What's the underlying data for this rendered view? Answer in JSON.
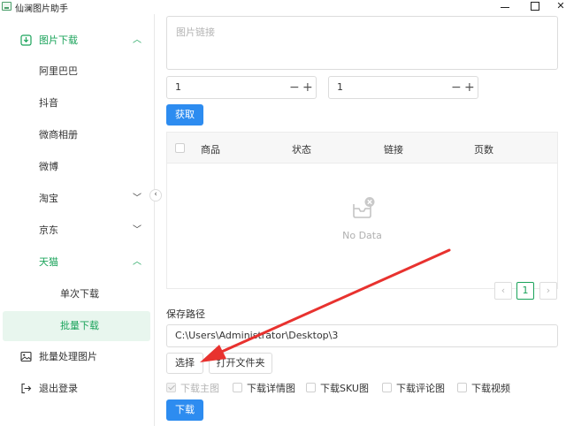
{
  "window": {
    "title": "仙澜图片助手"
  },
  "sidebar": {
    "items": [
      {
        "label": "图片下载",
        "type": "group",
        "expanded": true
      },
      {
        "label": "阿里巴巴"
      },
      {
        "label": "抖音"
      },
      {
        "label": "微商相册"
      },
      {
        "label": "微博"
      },
      {
        "label": "淘宝",
        "type": "group",
        "expanded": false
      },
      {
        "label": "京东",
        "type": "group",
        "expanded": false
      },
      {
        "label": "天猫",
        "type": "group",
        "expanded": true
      },
      {
        "label": "单次下载"
      },
      {
        "label": "批量下载",
        "selected": true
      },
      {
        "label": "批量处理图片"
      },
      {
        "label": "退出登录"
      }
    ]
  },
  "main": {
    "link_placeholder": "图片链接",
    "stepper_start": "1",
    "stepper_end": "1",
    "fetch_label": "获取",
    "table": {
      "columns": [
        "商品",
        "状态",
        "链接",
        "页数"
      ],
      "empty_text": "No Data"
    },
    "pagination": {
      "current_page": "1"
    },
    "save_path_label": "保存路径",
    "save_path_value": "C:\\Users\\Administrator\\Desktop\\3",
    "choose_label": "选择",
    "open_folder_label": "打开文件夹",
    "options": [
      {
        "label": "下载主图",
        "checked": true,
        "disabled": true
      },
      {
        "label": "下载详情图",
        "checked": false
      },
      {
        "label": "下载SKU图",
        "checked": false
      },
      {
        "label": "下载评论图",
        "checked": false
      },
      {
        "label": "下载视频",
        "checked": false
      }
    ],
    "download_label": "下载"
  },
  "colors": {
    "accent_green": "#1aa35a",
    "primary_blue": "#2d8cf0",
    "annotation_red": "#e8322f",
    "selected_bg": "#e8f6ee"
  }
}
